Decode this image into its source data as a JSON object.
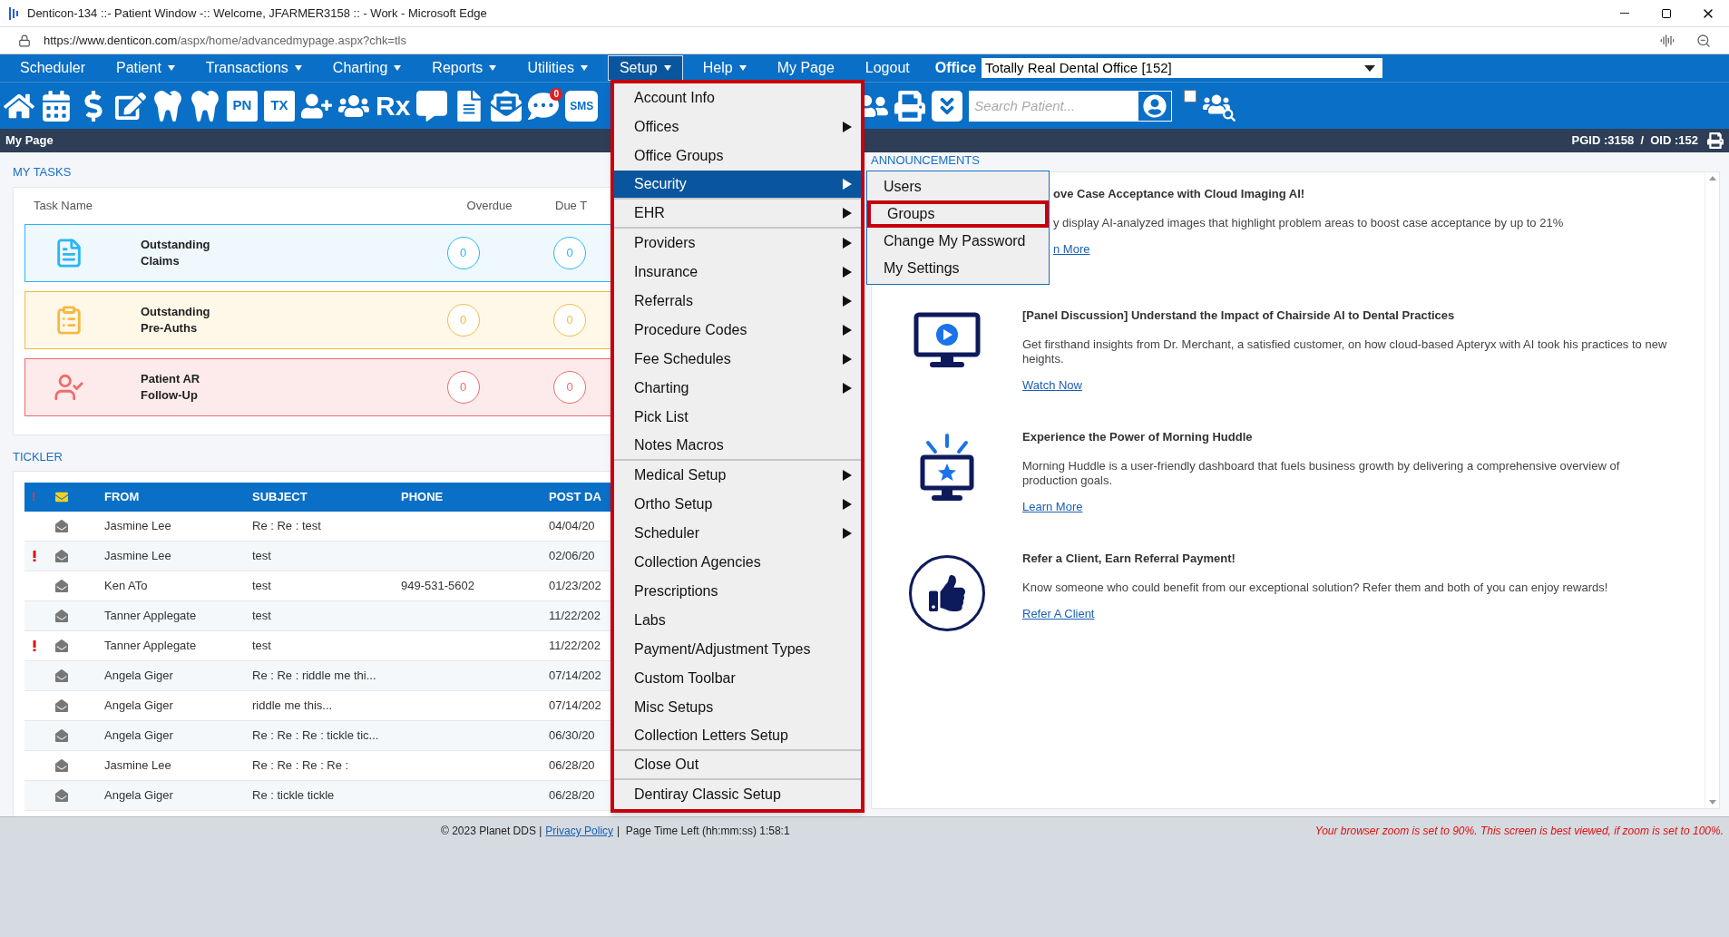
{
  "window": {
    "title": "Denticon-134 ::- Patient Window -:: Welcome, JFARMER3158 :: - Work - Microsoft Edge"
  },
  "address": {
    "origin": "https://www.denticon.com",
    "path": "/aspx/home/advancedmypage.aspx?chk=tls"
  },
  "menu_bar": [
    {
      "label": "Scheduler",
      "caret": false,
      "selected": false
    },
    {
      "label": "Patient",
      "caret": true,
      "selected": false
    },
    {
      "label": "Transactions",
      "caret": true,
      "selected": false
    },
    {
      "label": "Charting",
      "caret": true,
      "selected": false
    },
    {
      "label": "Reports",
      "caret": true,
      "selected": false
    },
    {
      "label": "Utilities",
      "caret": true,
      "selected": false
    },
    {
      "label": "Setup",
      "caret": true,
      "selected": true
    },
    {
      "label": "Help",
      "caret": true,
      "selected": false
    },
    {
      "label": "My Page",
      "caret": false,
      "selected": false
    },
    {
      "label": "Logout",
      "caret": false,
      "selected": false
    }
  ],
  "office": {
    "label": "Office",
    "value": "Totally Real Dental Office [152]"
  },
  "toolbar": {
    "pn": "PN",
    "tx": "TX",
    "rx": "Rx",
    "badge": "0",
    "sms": "SMS",
    "search_placeholder": "Search Patient...",
    "checked": false
  },
  "page_bar": {
    "title": "My Page",
    "ids": "PGID :3158  /  OID :152"
  },
  "tasks": {
    "heading": "MY TASKS",
    "columns": [
      "Task Name",
      "Overdue",
      "Due T"
    ],
    "items": [
      {
        "kind": "claims",
        "name": [
          "Outstanding",
          "Claims"
        ],
        "overdue": "0",
        "due": "0",
        "color": "#29b6f6"
      },
      {
        "kind": "preauths",
        "name": [
          "Outstanding",
          "Pre-Auths"
        ],
        "overdue": "0",
        "due": "0",
        "color": "#f5b942"
      },
      {
        "kind": "ar",
        "name": [
          "Patient AR",
          "Follow-Up"
        ],
        "overdue": "0",
        "due": "0",
        "color": "#ef6b6b"
      }
    ]
  },
  "tickler": {
    "heading": "TICKLER",
    "columns": [
      "!",
      "FROM",
      "SUBJECT",
      "PHONE",
      "POST DA"
    ],
    "rows": [
      {
        "urgent": false,
        "from": "Jasmine Lee",
        "subject": "Re : Re : test",
        "phone": "",
        "date": "04/04/20"
      },
      {
        "urgent": true,
        "from": "Jasmine Lee",
        "subject": "test",
        "phone": "",
        "date": "02/06/20"
      },
      {
        "urgent": false,
        "from": "Ken ATo",
        "subject": "test",
        "phone": "949-531-5602",
        "date": "01/23/202"
      },
      {
        "urgent": false,
        "from": "Tanner Applegate",
        "subject": "test",
        "phone": "",
        "date": "11/22/202"
      },
      {
        "urgent": true,
        "from": "Tanner Applegate",
        "subject": "test",
        "phone": "",
        "date": "11/22/202"
      },
      {
        "urgent": false,
        "from": "Angela Giger",
        "subject": "Re : Re : riddle me thi...",
        "phone": "",
        "date": "07/14/202"
      },
      {
        "urgent": false,
        "from": "Angela Giger",
        "subject": "riddle me this...",
        "phone": "",
        "date": "07/14/202"
      },
      {
        "urgent": false,
        "from": "Angela Giger",
        "subject": "Re : Re : Re : tickle tic...",
        "phone": "",
        "date": "06/30/20"
      },
      {
        "urgent": false,
        "from": "Jasmine Lee",
        "subject": "Re : Re : Re : Re :",
        "phone": "",
        "date": "06/28/20"
      },
      {
        "urgent": false,
        "from": "Angela Giger",
        "subject": "Re : tickle tickle",
        "phone": "",
        "date": "06/28/20"
      }
    ]
  },
  "announcements": {
    "heading": "ANNOUNCEMENTS",
    "items": [
      {
        "title": "ove Case Acceptance with Cloud Imaging AI!",
        "body": "y display AI-analyzed images that highlight problem areas to boost case acceptance by up to 21%",
        "link": "n More"
      },
      {
        "kind": "video",
        "title": "[Panel Discussion] Understand the Impact of Chairside AI to Dental Practices",
        "body": "Get firsthand insights from Dr. Merchant, a satisfied customer, on how cloud-based Apteryx with AI took his practices to new heights.",
        "link": "Watch Now"
      },
      {
        "kind": "huddle",
        "title": "Experience the Power of Morning Huddle",
        "body": "Morning Huddle is a user-friendly dashboard that fuels business growth by delivering a comprehensive overview of production goals.",
        "link": "Learn More"
      },
      {
        "kind": "referral",
        "title": "Refer a Client, Earn Referral Payment!",
        "body": "Know someone who could benefit from our exceptional solution? Refer them and both of you can enjoy rewards!",
        "link": "Refer A Client"
      }
    ]
  },
  "setup_menu": [
    {
      "label": "Account Info",
      "submenu": false,
      "selected": false,
      "divider": false
    },
    {
      "label": "Offices",
      "submenu": true,
      "selected": false,
      "divider": false
    },
    {
      "label": "Office Groups",
      "submenu": false,
      "selected": false,
      "divider": false
    },
    {
      "label": "Security",
      "submenu": true,
      "selected": true,
      "divider": true
    },
    {
      "label": "EHR",
      "submenu": true,
      "selected": false,
      "divider": true
    },
    {
      "label": "Providers",
      "submenu": true,
      "selected": false,
      "divider": false
    },
    {
      "label": "Insurance",
      "submenu": true,
      "selected": false,
      "divider": false
    },
    {
      "label": "Referrals",
      "submenu": true,
      "selected": false,
      "divider": false
    },
    {
      "label": "Procedure Codes",
      "submenu": true,
      "selected": false,
      "divider": false
    },
    {
      "label": "Fee Schedules",
      "submenu": true,
      "selected": false,
      "divider": false
    },
    {
      "label": "Charting",
      "submenu": true,
      "selected": false,
      "divider": false
    },
    {
      "label": "Pick List",
      "submenu": false,
      "selected": false,
      "divider": false
    },
    {
      "label": "Notes Macros",
      "submenu": false,
      "selected": false,
      "divider": true
    },
    {
      "label": "Medical Setup",
      "submenu": true,
      "selected": false,
      "divider": false
    },
    {
      "label": "Ortho Setup",
      "submenu": true,
      "selected": false,
      "divider": false
    },
    {
      "label": "Scheduler",
      "submenu": true,
      "selected": false,
      "divider": false
    },
    {
      "label": "Collection Agencies",
      "submenu": false,
      "selected": false,
      "divider": false
    },
    {
      "label": "Prescriptions",
      "submenu": false,
      "selected": false,
      "divider": false
    },
    {
      "label": "Labs",
      "submenu": false,
      "selected": false,
      "divider": false
    },
    {
      "label": "Payment/Adjustment Types",
      "submenu": false,
      "selected": false,
      "divider": false
    },
    {
      "label": "Custom Toolbar",
      "submenu": false,
      "selected": false,
      "divider": false
    },
    {
      "label": "Misc Setups",
      "submenu": false,
      "selected": false,
      "divider": false
    },
    {
      "label": "Collection Letters Setup",
      "submenu": false,
      "selected": false,
      "divider": true
    },
    {
      "label": "Close Out",
      "submenu": false,
      "selected": false,
      "divider": true
    },
    {
      "label": "Dentiray Classic Setup",
      "submenu": false,
      "selected": false,
      "divider": false
    }
  ],
  "security_submenu": [
    {
      "label": "Users",
      "marked": false
    },
    {
      "label": "Groups",
      "marked": true
    },
    {
      "label": "Change My Password",
      "marked": false
    },
    {
      "label": "My Settings",
      "marked": false
    }
  ],
  "footer": {
    "copyright": "© 2023 Planet DDS |",
    "link": "Privacy Policy",
    "time": "|  Page Time Left (hh:mm:ss) 1:58:1",
    "warning": "Your browser zoom is set to 90%. This screen is best viewed, if zoom is set to 100%."
  }
}
